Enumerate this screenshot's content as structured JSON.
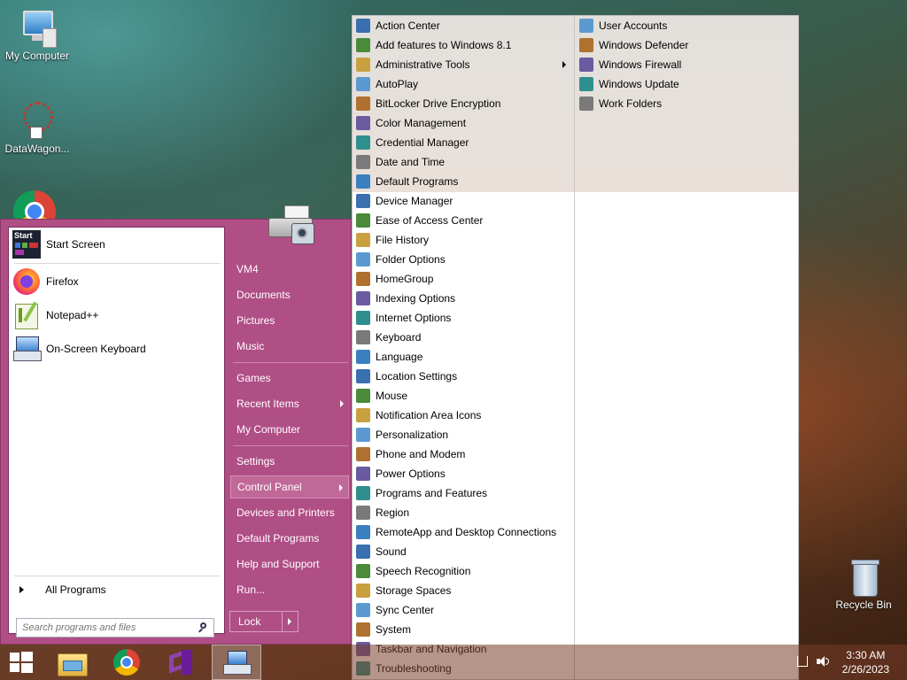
{
  "desktop": {
    "icons": [
      {
        "label": "My Computer"
      },
      {
        "label": "DataWagon..."
      },
      {
        "label": "Recycle Bin"
      }
    ]
  },
  "start_menu": {
    "pinned": [
      {
        "label": "Start Screen",
        "icon": "start-screen-icon"
      },
      {
        "label": "Firefox",
        "icon": "firefox-icon"
      },
      {
        "label": "Notepad++",
        "icon": "notepad-plus-plus-icon"
      },
      {
        "label": "On-Screen Keyboard",
        "icon": "keyboard-icon"
      }
    ],
    "all_programs": "All Programs",
    "search_placeholder": "Search programs and files",
    "right_items": [
      {
        "label": "VM4"
      },
      {
        "label": "Documents"
      },
      {
        "label": "Pictures"
      },
      {
        "label": "Music"
      },
      {
        "label": "Games"
      },
      {
        "label": "Recent Items"
      },
      {
        "label": "My Computer"
      },
      {
        "label": "Settings"
      },
      {
        "label": "Control Panel"
      },
      {
        "label": "Devices and Printers"
      },
      {
        "label": "Default Programs"
      },
      {
        "label": "Help and Support"
      },
      {
        "label": "Run..."
      }
    ],
    "lock_label": "Lock"
  },
  "control_panel": {
    "col1": [
      "Action Center",
      "Add features to Windows 8.1",
      "Administrative Tools",
      "AutoPlay",
      "BitLocker Drive Encryption",
      "Color Management",
      "Credential Manager",
      "Date and Time",
      "Default Programs",
      "Device Manager",
      "Ease of Access Center",
      "File History",
      "Folder Options",
      "HomeGroup",
      "Indexing Options",
      "Internet Options",
      "Keyboard",
      "Language",
      "Location Settings",
      "Mouse",
      "Notification Area Icons",
      "Personalization",
      "Phone and Modem",
      "Power Options",
      "Programs and Features",
      "Region",
      "RemoteApp and Desktop Connections",
      "Sound",
      "Speech Recognition",
      "Storage Spaces",
      "Sync Center",
      "System",
      "Taskbar and Navigation",
      "Troubleshooting"
    ],
    "col2": [
      "User Accounts",
      "Windows Defender",
      "Windows Firewall",
      "Windows Update",
      "Work Folders"
    ]
  },
  "taskbar": {
    "time": "3:30 AM",
    "date": "2/26/2023"
  },
  "colors": {
    "start_menu_bg": "#b04e86",
    "highlight": "#c06898"
  }
}
